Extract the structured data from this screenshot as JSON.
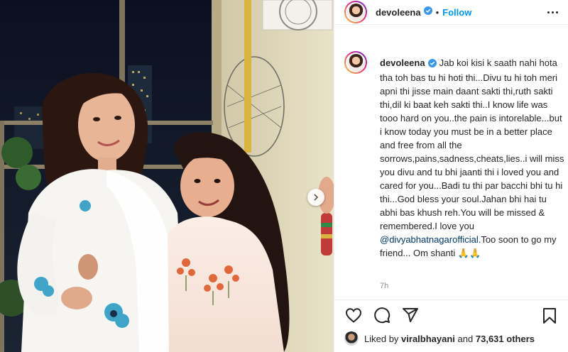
{
  "post": {
    "username": "devoleena",
    "follow_label": "Follow",
    "header_separator": "•",
    "caption": "Jab koi kisi k saath nahi hota tha toh bas tu hi hoti thi...Divu tu hi toh meri apni thi jisse main daant sakti thi,ruth sakti thi,dil ki baat keh sakti thi..I know life was tooo hard on you..the pain is intorelable...but i know today you must be in a better place and free from all the sorrows,pains,sadness,cheats,lies..i will miss you divu and tu bhi jaanti thi i loved you and cared for you...Badi tu thi par bacchi bhi tu hi thi...God bless your soul.Jahan bhi hai tu abhi bas khush reh.You will be missed & remembered.I love you",
    "mention": "@divyabhatnagarofficial",
    "caption_tail": ".Too soon to go my friend... Om shanti 🙏🙏",
    "time_ago": "7h",
    "likes": {
      "prefix": "Liked by ",
      "user": "viralbhayani",
      "conjunction": " and ",
      "others": "73,631 others"
    }
  },
  "icons": {
    "verified": "verified-badge-icon",
    "more": "more-options-icon",
    "like": "heart-icon",
    "comment": "comment-icon",
    "share": "send-icon",
    "save": "bookmark-icon",
    "next": "chevron-right-icon"
  },
  "colors": {
    "accent": "#0095f6",
    "mention": "#00376b",
    "text": "#262626",
    "muted": "#8e8e8e",
    "border": "#efefef"
  }
}
